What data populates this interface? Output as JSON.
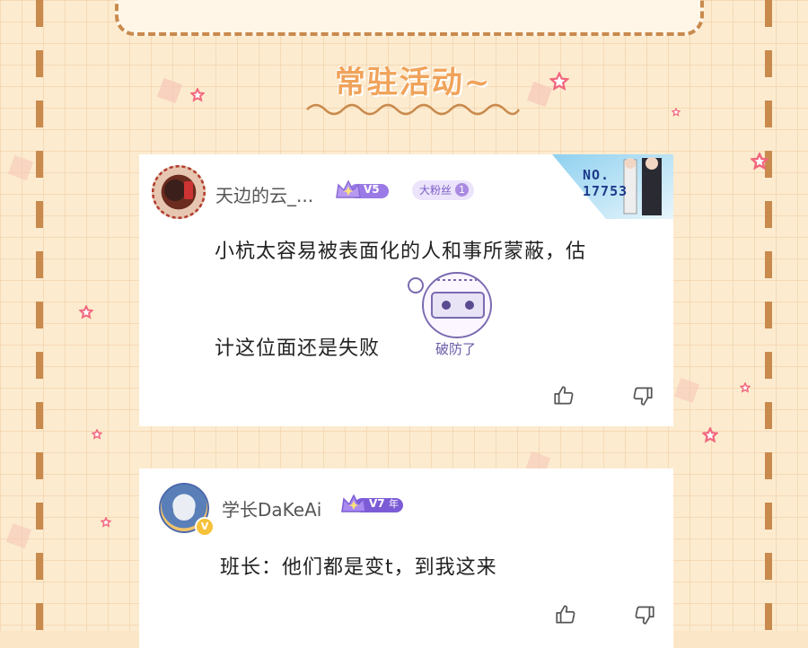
{
  "banner": {
    "text": ""
  },
  "section_title": "常驻活动~",
  "comments": [
    {
      "username": "天边的云_...",
      "vip_level": "V5",
      "fan_badge_label": "大粉丝",
      "fan_badge_level": "1",
      "decoration_number": "NO.\n17753",
      "text_line1": "小杭太容易被表面化的人和事所蒙蔽，估",
      "text_line2": "计这位面还是失败",
      "sticker_text": "破防了",
      "like_icon": "thumbs-up-icon",
      "dislike_icon": "thumbs-down-icon"
    },
    {
      "username": "学长DaKeAi",
      "vip_level": "V7",
      "vip_suffix": "年",
      "verified_mark": "V",
      "text": "班长：他们都是变t，到我这来",
      "like_icon": "thumbs-up-icon",
      "dislike_icon": "thumbs-down-icon"
    }
  ],
  "colors": {
    "accent_orange": "#f0a35a",
    "dash_brown": "#c98a4d",
    "vip_purple": "#8a6ad6",
    "star_pink": "#f2677e"
  }
}
